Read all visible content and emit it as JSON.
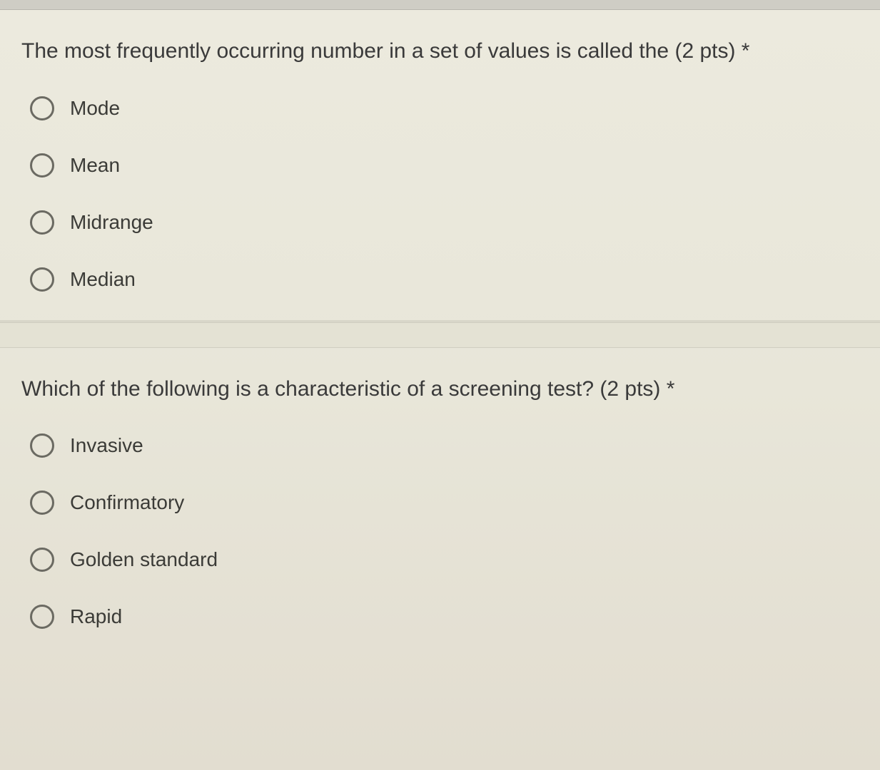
{
  "questions": [
    {
      "prompt": "The most frequently occurring number in a set of values is called the (2 pts) *",
      "options": [
        "Mode",
        "Mean",
        "Midrange",
        "Median"
      ]
    },
    {
      "prompt": "Which of the following is a characteristic of a screening test? (2 pts) *",
      "options": [
        "Invasive",
        "Confirmatory",
        "Golden standard",
        "Rapid"
      ]
    }
  ]
}
